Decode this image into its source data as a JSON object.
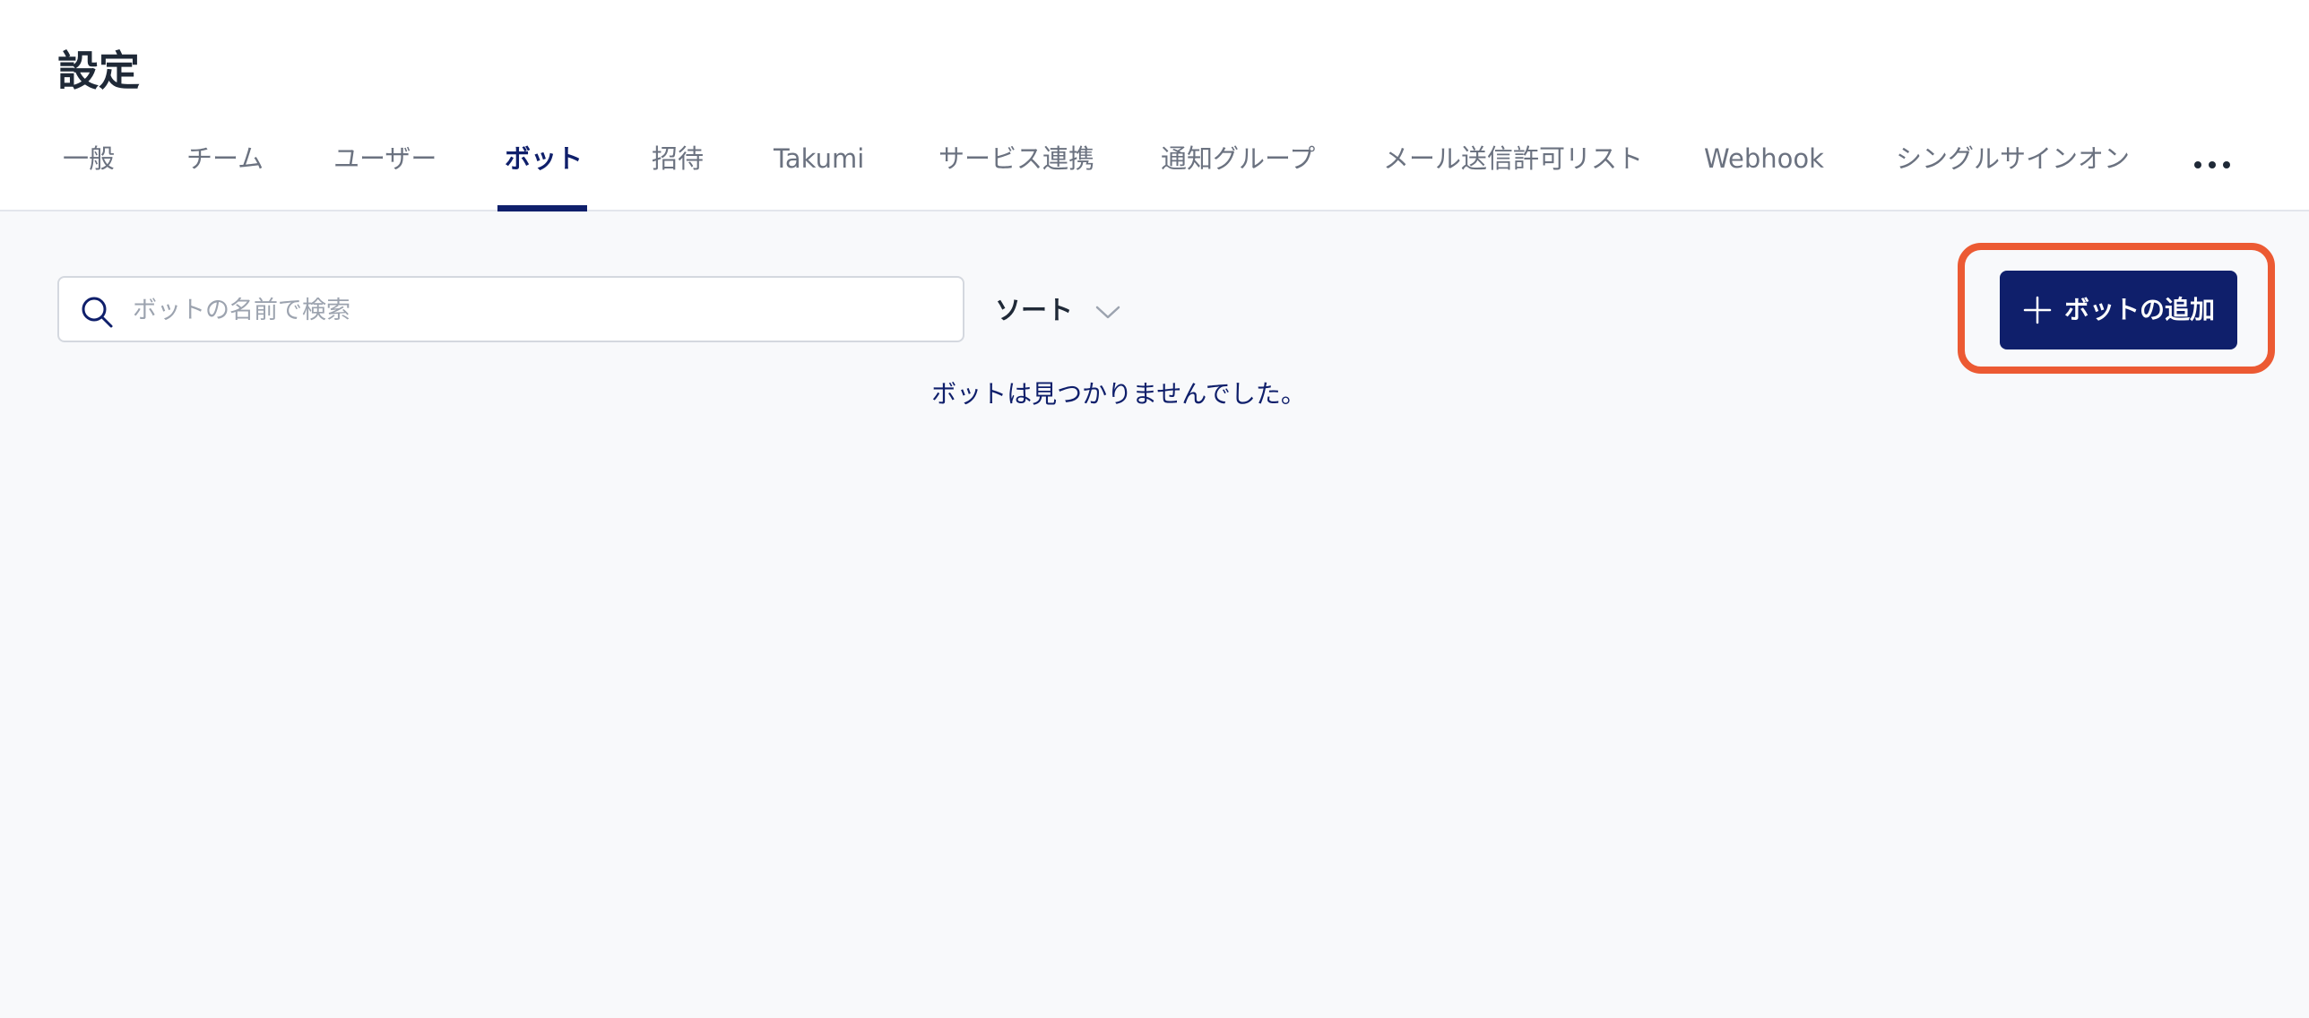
{
  "page": {
    "title": "設定"
  },
  "tabs": [
    {
      "label": "一般",
      "active": false
    },
    {
      "label": "チーム",
      "active": false
    },
    {
      "label": "ユーザー",
      "active": false
    },
    {
      "label": "ボット",
      "active": true
    },
    {
      "label": "招待",
      "active": false
    },
    {
      "label": "Takumi",
      "active": false
    },
    {
      "label": "サービス連携",
      "active": false
    },
    {
      "label": "通知グループ",
      "active": false
    },
    {
      "label": "メール送信許可リスト",
      "active": false
    },
    {
      "label": "Webhook",
      "active": false
    },
    {
      "label": "シングルサインオン",
      "active": false
    }
  ],
  "more_tabs_icon": "more-horizontal-icon",
  "search": {
    "placeholder": "ボットの名前で検索",
    "value": "",
    "icon": "search-icon"
  },
  "sort": {
    "label": "ソート",
    "icon": "chevron-down-icon"
  },
  "add_bot": {
    "label": "ボットの追加",
    "icon": "plus-icon"
  },
  "empty_state": {
    "message": "ボットは見つかりませんでした。"
  },
  "colors": {
    "brand": "#0f1f6b",
    "highlight": "#ec5a33",
    "background": "#f8f9fb",
    "tab_inactive": "#6b7280"
  }
}
